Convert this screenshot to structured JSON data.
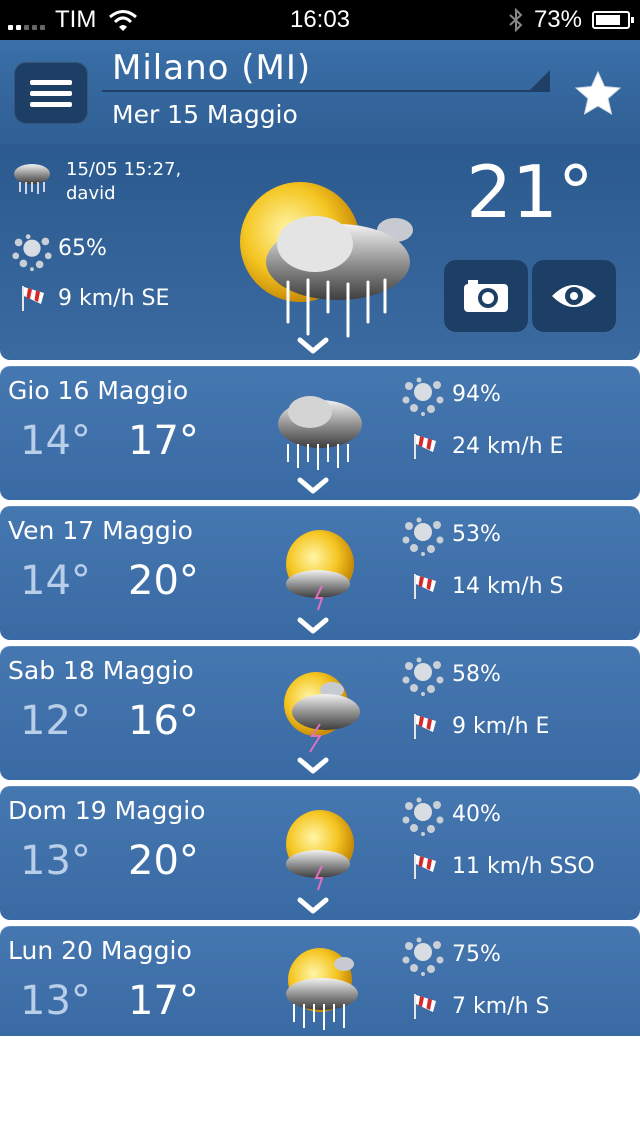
{
  "status_bar": {
    "carrier": "TIM",
    "time": "16:03",
    "battery": "73%",
    "battery_level": 0.73
  },
  "header": {
    "city": "Milano (MI)",
    "date": "Mer 15 Maggio",
    "icons": {
      "menu": "menu-icon",
      "favorite": "star-icon"
    }
  },
  "current": {
    "observation_time": "15/05 15:27,",
    "observer": "david",
    "humidity": "65%",
    "wind": "9 km/h SE",
    "temperature": "21°",
    "condition_icon": "sun-cloud-rain-icon",
    "buttons": {
      "camera": "camera-icon",
      "view": "eye-icon"
    }
  },
  "forecast": [
    {
      "day": "Gio 16 Maggio",
      "min": "14°",
      "max": "17°",
      "humidity": "94%",
      "wind": "24 km/h E",
      "icon": "cloud-rain-icon"
    },
    {
      "day": "Ven 17 Maggio",
      "min": "14°",
      "max": "20°",
      "humidity": "53%",
      "wind": "14 km/h S",
      "icon": "sun-cloud-storm-icon"
    },
    {
      "day": "Sab 18 Maggio",
      "min": "12°",
      "max": "16°",
      "humidity": "58%",
      "wind": "9 km/h E",
      "icon": "sun-cloud-storm-icon"
    },
    {
      "day": "Dom 19 Maggio",
      "min": "13°",
      "max": "20°",
      "humidity": "40%",
      "wind": "11 km/h SSO",
      "icon": "sun-cloud-storm-icon"
    },
    {
      "day": "Lun 20 Maggio",
      "min": "13°",
      "max": "17°",
      "humidity": "75%",
      "wind": "7 km/h S",
      "icon": "sun-cloud-rain-icon"
    }
  ],
  "colors": {
    "header": "#3a6fa8",
    "panel": "#4577b0",
    "button": "#1d3f66",
    "min_temp": "#b9cfe9"
  }
}
